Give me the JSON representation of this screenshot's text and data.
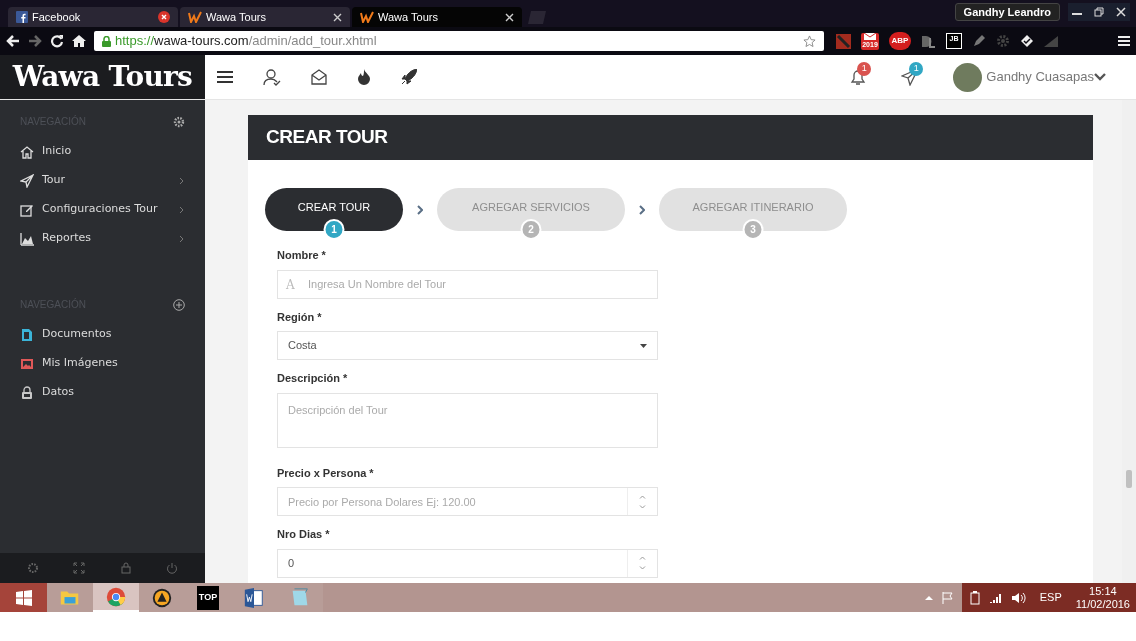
{
  "browser": {
    "tabs": [
      {
        "title": "Facebook",
        "kind": "facebook",
        "selected": false
      },
      {
        "title": "Wawa Tours",
        "kind": "wawa",
        "selected": false
      },
      {
        "title": "Wawa Tours",
        "kind": "wawa",
        "selected": true
      }
    ],
    "profile": "Gandhy Leandro",
    "url": {
      "scheme": "https://",
      "host": "wawa-tours.com",
      "path": "/admin/add_tour.xhtml"
    },
    "extensions": [
      {
        "kind": "dota"
      },
      {
        "kind": "mail",
        "label": "2019"
      },
      {
        "kind": "abp",
        "label": "ABP"
      },
      {
        "kind": "dl"
      },
      {
        "kind": "jb",
        "label": "JB"
      },
      {
        "kind": "pen"
      },
      {
        "kind": "gear"
      },
      {
        "kind": "diamond"
      },
      {
        "kind": "signal"
      }
    ]
  },
  "header": {
    "logo": "Wawa Tours",
    "notifications": "1",
    "messages": "1",
    "user": "Gandhy Cuasapas"
  },
  "sidebar": {
    "sections": [
      {
        "title": "NAVEGACIÓN",
        "items": [
          {
            "label": "Inicio",
            "submenu": false
          },
          {
            "label": "Tour",
            "submenu": true
          },
          {
            "label": "Configuraciones Tour",
            "submenu": true
          },
          {
            "label": "Reportes",
            "submenu": true
          }
        ]
      },
      {
        "title": "NAVEGACIÓN",
        "items": [
          {
            "label": "Documentos",
            "color": "#3bb4d8"
          },
          {
            "label": "Mis Imágenes",
            "color": "#e05858"
          },
          {
            "label": "Datos",
            "color": "#c8c8c8"
          }
        ]
      }
    ]
  },
  "page": {
    "title": "CREAR TOUR",
    "steps": [
      {
        "label": "CREAR TOUR",
        "number": "1",
        "selected": true
      },
      {
        "label": "AGREGAR SERVICIOS",
        "number": "2",
        "selected": false
      },
      {
        "label": "AGREGAR ITINERARIO",
        "number": "3",
        "selected": false
      }
    ],
    "fields": [
      {
        "kind": "text",
        "label": "Nombre *",
        "prefix": "A",
        "placeholder": "Ingresa Un Nombre del Tour"
      },
      {
        "kind": "select",
        "label": "Región *",
        "value": "Costa"
      },
      {
        "kind": "textarea",
        "label": "Descripción *",
        "placeholder": "Descripción del Tour"
      },
      {
        "kind": "number",
        "label": "Precio x Persona *",
        "placeholder": "Precio por Persona Dolares Ej: 120.00"
      },
      {
        "kind": "number",
        "label": "Nro Dias *",
        "value": "0"
      }
    ]
  },
  "taskbar": {
    "apps": [
      {
        "kind": "explorer",
        "selected": false
      },
      {
        "kind": "chrome",
        "selected": true
      },
      {
        "kind": "aimp",
        "selected": false
      },
      {
        "kind": "toplatino",
        "label": "TOP",
        "selected": false
      },
      {
        "kind": "word",
        "selected": false
      },
      {
        "kind": "notepad",
        "selected": false
      }
    ],
    "tray": {
      "language": "ESP",
      "time": "15:14",
      "date": "11/02/2016"
    }
  }
}
